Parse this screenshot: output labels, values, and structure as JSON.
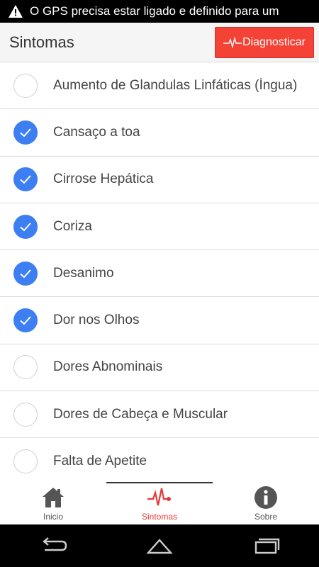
{
  "status": {
    "message": "O GPS precisa estar ligado e definido para um"
  },
  "app_bar": {
    "title": "Sintomas",
    "diagnose_label": "Diagnosticar",
    "accent": "#f44336"
  },
  "symptoms": [
    {
      "label": "Aumento de Glandulas Linfáticas (Íngua)",
      "checked": false
    },
    {
      "label": "Cansaço a toa",
      "checked": true
    },
    {
      "label": "Cirrose Hepática",
      "checked": true
    },
    {
      "label": "Coriza",
      "checked": true
    },
    {
      "label": "Desanimo",
      "checked": true
    },
    {
      "label": "Dor nos Olhos",
      "checked": true
    },
    {
      "label": "Dores Abnominais",
      "checked": false
    },
    {
      "label": "Dores de Cabeça e Muscular",
      "checked": false
    },
    {
      "label": "Falta de Apetite",
      "checked": false
    }
  ],
  "bottom_nav": {
    "inicio": "Inicio",
    "sintomas": "Sintomas",
    "sobre": "Sobre",
    "active": "sintomas"
  },
  "colors": {
    "check_on": "#3d7ff2",
    "active_tab": "#e53935"
  }
}
